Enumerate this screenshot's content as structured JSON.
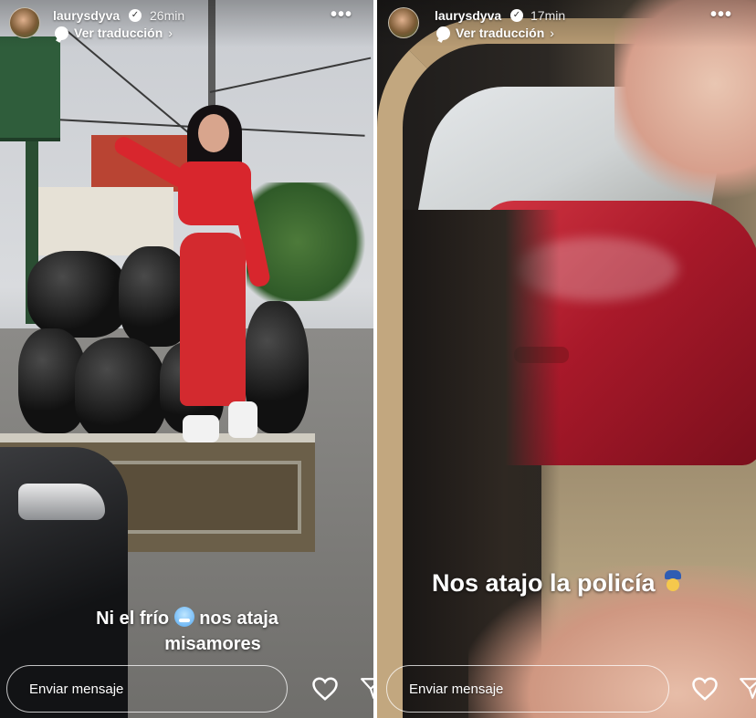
{
  "stories": [
    {
      "username": "laurysdyva",
      "time": "26min",
      "translate_label": "Ver traducción",
      "caption_line1_before": "Ni el frío",
      "caption_line1_after": "nos ataja",
      "caption_line2": "misamores",
      "reply_placeholder": "Enviar mensaje"
    },
    {
      "username": "laurysdyva",
      "time": "17min",
      "translate_label": "Ver traducción",
      "caption": "Nos atajo la policía",
      "reply_placeholder": "Enviar mensaje"
    }
  ],
  "icons": {
    "verified": "verified-badge-icon",
    "translate": "speech-bubble-icon",
    "more": "more-horizontal-icon",
    "heart": "heart-outline-icon",
    "send": "paper-plane-icon",
    "emoji_left": "cold-face-emoji",
    "emoji_right": "police-officer-emoji"
  },
  "colors": {
    "overlay_text": "#ffffff",
    "outfit_red": "#d8262d",
    "car_red": "#b8202f"
  }
}
